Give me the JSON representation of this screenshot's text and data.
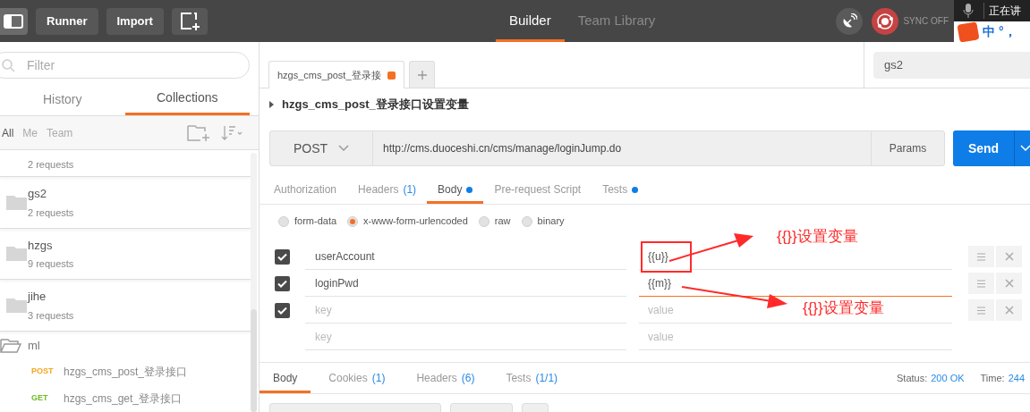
{
  "toolbar": {
    "buttons": [
      "Runner",
      "Import"
    ],
    "tabs": [
      {
        "label": "Builder",
        "selected": true
      },
      {
        "label": "Team Library",
        "selected": false
      }
    ],
    "sync": "SYNC OFF"
  },
  "ime": {
    "status": "正在讲",
    "mode": "中",
    "punct": "°，"
  },
  "sidebar": {
    "filter": {
      "placeholder": "Filter"
    },
    "tabs": [
      {
        "label": "History",
        "selected": false
      },
      {
        "label": "Collections",
        "selected": true
      }
    ],
    "filters": [
      {
        "label": "All",
        "selected": true
      },
      {
        "label": "Me",
        "selected": false
      },
      {
        "label": "Team",
        "selected": false
      }
    ],
    "collections": [
      {
        "count": "2 requests"
      },
      {
        "name": "gs2",
        "count": "2 requests"
      },
      {
        "name": "hzgs",
        "count": "9 requests"
      },
      {
        "name": "jihe",
        "count": "3 requests"
      },
      {
        "name": "ml",
        "expanded": true,
        "requests": [
          {
            "method": "POST",
            "name": "hzgs_cms_post_登录接口"
          },
          {
            "method": "GET",
            "name": "hzgs_cms_get_登录接口"
          }
        ]
      }
    ]
  },
  "request_tabs": [
    {
      "label": "hzgs_cms_post_登录接",
      "selected": true,
      "unsaved": true
    }
  ],
  "environment": "gs2",
  "request_title": "hzgs_cms_post_登录接口设置变量",
  "method": "POST",
  "url": "http://cms.duoceshi.cn/cms/manage/loginJump.do",
  "params_button": "Params",
  "send_button": "Send",
  "request_subtabs": [
    {
      "label": "Authorization",
      "selected": false
    },
    {
      "label": "Headers",
      "count": "(1)",
      "selected": false
    },
    {
      "label": "Body",
      "dot": true,
      "selected": true
    },
    {
      "label": "Pre-request Script",
      "selected": false
    },
    {
      "label": "Tests",
      "dot": true,
      "selected": false
    }
  ],
  "body_types": [
    {
      "label": "form-data",
      "selected": false
    },
    {
      "label": "x-www-form-urlencoded",
      "selected": true
    },
    {
      "label": "raw",
      "selected": false
    },
    {
      "label": "binary",
      "selected": false
    }
  ],
  "params": [
    {
      "kind": "entry",
      "checked": true,
      "key": "userAccount",
      "value": "{{u}}",
      "focused": false
    },
    {
      "kind": "entry",
      "checked": true,
      "key": "loginPwd",
      "value": "{{m}}",
      "focused": true
    },
    {
      "kind": "entry",
      "checked": true,
      "key_placeholder": "key",
      "value_placeholder": "value",
      "focused": false
    },
    {
      "kind": "new",
      "key_placeholder": "key",
      "value_placeholder": "value",
      "focused": false
    }
  ],
  "annotations": [
    "{{}}设置变量",
    "{{}}设置变量"
  ],
  "response": {
    "tabs": [
      {
        "label": "Body",
        "selected": true
      },
      {
        "label": "Cookies",
        "count": "(1)",
        "selected": false
      },
      {
        "label": "Headers",
        "count": "(6)",
        "selected": false
      },
      {
        "label": "Tests",
        "count": "(1/1)",
        "selected": false
      }
    ],
    "status_label": "Status:",
    "status": "200 OK",
    "time_label": "Time:",
    "time": "244"
  }
}
